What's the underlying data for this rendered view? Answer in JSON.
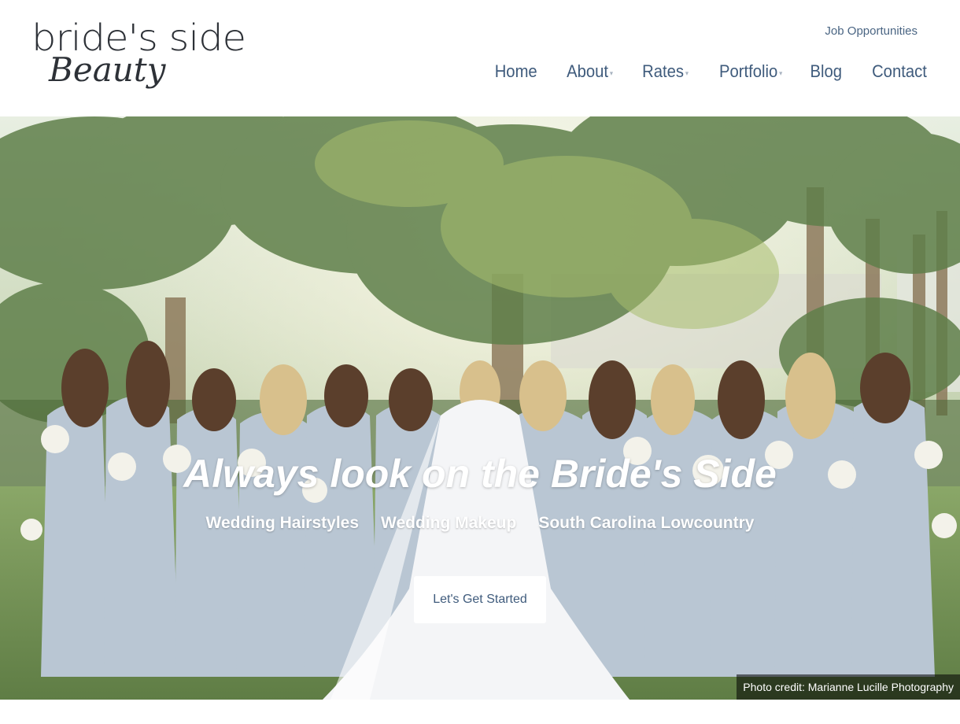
{
  "header": {
    "logo": {
      "line1": "bride's side",
      "line2": "Beauty"
    },
    "top_link": "Job Opportunities",
    "nav": [
      {
        "label": "Home",
        "dropdown": false
      },
      {
        "label": "About",
        "dropdown": true
      },
      {
        "label": "Rates",
        "dropdown": true
      },
      {
        "label": "Portfolio",
        "dropdown": true
      },
      {
        "label": "Blog",
        "dropdown": false
      },
      {
        "label": "Contact",
        "dropdown": false
      }
    ],
    "caret_glyph": "▾"
  },
  "hero": {
    "tagline": "Always look on the Bride's Side",
    "services": [
      "Wedding Hairstyles",
      "Wedding Makeup",
      "South Carolina Lowcountry"
    ],
    "cta_label": "Let's Get Started",
    "photo_credit": "Photo credit: Marianne Lucille Photography"
  },
  "colors": {
    "nav_text": "#3f5b7c",
    "logo_text": "#2d3137",
    "dress": "#b9c6d3",
    "palm": "#6f8f5a",
    "grass": "#7f9a5e"
  }
}
